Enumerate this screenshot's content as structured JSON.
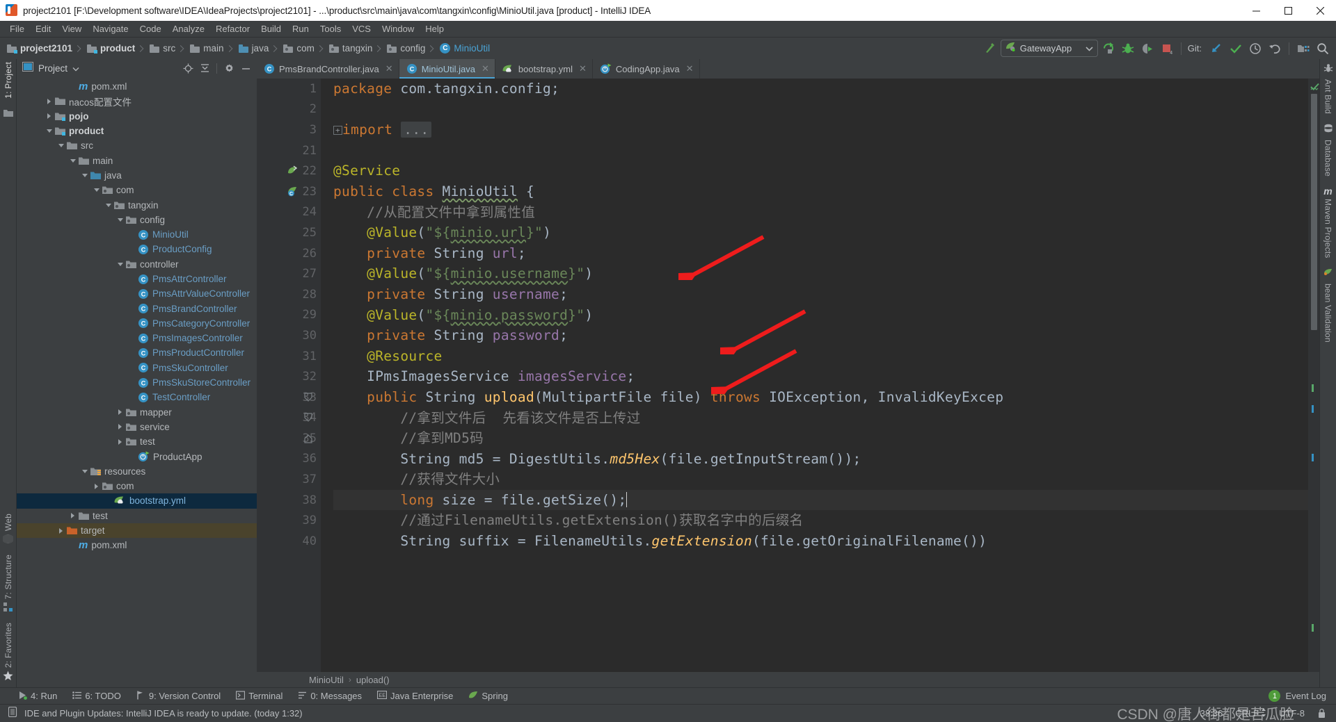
{
  "window": {
    "title": "project2101 [F:\\Development software\\IDEA\\IdeaProjects\\project2101] - ...\\product\\src\\main\\java\\com\\tangxin\\config\\MinioUtil.java [product] - IntelliJ IDEA",
    "minimize_label": "Minimize",
    "maximize_label": "Maximize",
    "close_label": "Close"
  },
  "menubar": {
    "items": [
      "File",
      "Edit",
      "View",
      "Navigate",
      "Code",
      "Analyze",
      "Refactor",
      "Build",
      "Run",
      "Tools",
      "VCS",
      "Window",
      "Help"
    ]
  },
  "navbar": {
    "crumbs": [
      {
        "label": "project2101",
        "icon": "folder-module-icon",
        "bold": true
      },
      {
        "label": "product",
        "icon": "folder-module-icon",
        "bold": true
      },
      {
        "label": "src",
        "icon": "folder-icon",
        "bold": false
      },
      {
        "label": "main",
        "icon": "folder-icon",
        "bold": false
      },
      {
        "label": "java",
        "icon": "folder-source-icon",
        "bold": false
      },
      {
        "label": "com",
        "icon": "folder-package-icon",
        "bold": false
      },
      {
        "label": "tangxin",
        "icon": "folder-package-icon",
        "bold": false
      },
      {
        "label": "config",
        "icon": "folder-package-icon",
        "bold": false
      },
      {
        "label": "MinioUtil",
        "icon": "class-icon",
        "bold": false
      }
    ],
    "run_config": "GatewayApp",
    "git_label": "Git:",
    "icons": [
      "build-icon",
      "run-icon",
      "debug-icon",
      "run-with-coverage-icon",
      "stop-icon",
      "git-update-icon",
      "git-commit-icon",
      "git-history-icon",
      "git-rollback-icon",
      "project-structure-icon",
      "search-everywhere-icon"
    ]
  },
  "left_strip": {
    "top": [
      "1: Project"
    ],
    "bottom": [
      "2: Favorites",
      "7: Structure",
      "Web"
    ]
  },
  "right_strip": {
    "items": [
      "Ant Build",
      "Database",
      "Maven Projects",
      "bean Validation"
    ]
  },
  "project_panel": {
    "title": "Project",
    "actions": [
      "locate-icon",
      "collapse-all-icon",
      "settings-gear-icon",
      "hide-icon"
    ],
    "tree": [
      {
        "label": "pom.xml",
        "indent": 4,
        "arrow": "none",
        "icon": "maven-icon",
        "bold": false
      },
      {
        "label": "nacos配置文件",
        "indent": 2,
        "arrow": "right",
        "icon": "folder-icon",
        "bold": false
      },
      {
        "label": "pojo",
        "indent": 2,
        "arrow": "right",
        "icon": "folder-module-icon",
        "bold": true
      },
      {
        "label": "product",
        "indent": 2,
        "arrow": "down",
        "icon": "folder-module-icon",
        "bold": true
      },
      {
        "label": "src",
        "indent": 3,
        "arrow": "down",
        "icon": "folder-icon",
        "bold": false
      },
      {
        "label": "main",
        "indent": 4,
        "arrow": "down",
        "icon": "folder-icon",
        "bold": false
      },
      {
        "label": "java",
        "indent": 5,
        "arrow": "down",
        "icon": "folder-source-icon",
        "bold": false
      },
      {
        "label": "com",
        "indent": 6,
        "arrow": "down",
        "icon": "folder-package-icon",
        "bold": false
      },
      {
        "label": "tangxin",
        "indent": 7,
        "arrow": "down",
        "icon": "folder-package-icon",
        "bold": false
      },
      {
        "label": "config",
        "indent": 8,
        "arrow": "down",
        "icon": "folder-package-icon",
        "bold": false
      },
      {
        "label": "MinioUtil",
        "indent": 9,
        "arrow": "none",
        "icon": "class-icon",
        "bold": false
      },
      {
        "label": "ProductConfig",
        "indent": 9,
        "arrow": "none",
        "icon": "class-icon",
        "bold": false
      },
      {
        "label": "controller",
        "indent": 8,
        "arrow": "down",
        "icon": "folder-package-icon",
        "bold": false
      },
      {
        "label": "PmsAttrController",
        "indent": 9,
        "arrow": "none",
        "icon": "class-icon",
        "bold": false
      },
      {
        "label": "PmsAttrValueController",
        "indent": 9,
        "arrow": "none",
        "icon": "class-icon",
        "bold": false
      },
      {
        "label": "PmsBrandController",
        "indent": 9,
        "arrow": "none",
        "icon": "class-icon",
        "bold": false
      },
      {
        "label": "PmsCategoryController",
        "indent": 9,
        "arrow": "none",
        "icon": "class-icon",
        "bold": false
      },
      {
        "label": "PmsImagesController",
        "indent": 9,
        "arrow": "none",
        "icon": "class-icon",
        "bold": false
      },
      {
        "label": "PmsProductController",
        "indent": 9,
        "arrow": "none",
        "icon": "class-icon",
        "bold": false
      },
      {
        "label": "PmsSkuController",
        "indent": 9,
        "arrow": "none",
        "icon": "class-icon",
        "bold": false
      },
      {
        "label": "PmsSkuStoreController",
        "indent": 9,
        "arrow": "none",
        "icon": "class-icon",
        "bold": false
      },
      {
        "label": "TestController",
        "indent": 9,
        "arrow": "none",
        "icon": "class-icon",
        "bold": false
      },
      {
        "label": "mapper",
        "indent": 8,
        "arrow": "right",
        "icon": "folder-package-icon",
        "bold": false
      },
      {
        "label": "service",
        "indent": 8,
        "arrow": "right",
        "icon": "folder-package-icon",
        "bold": false
      },
      {
        "label": "test",
        "indent": 8,
        "arrow": "right",
        "icon": "folder-package-icon",
        "bold": false
      },
      {
        "label": "ProductApp",
        "indent": 9,
        "arrow": "none",
        "icon": "spring-app-icon",
        "bold": false
      },
      {
        "label": "resources",
        "indent": 5,
        "arrow": "down",
        "icon": "folder-resources-icon",
        "bold": false
      },
      {
        "label": "com",
        "indent": 6,
        "arrow": "right",
        "icon": "folder-package-icon",
        "bold": false
      },
      {
        "label": "bootstrap.yml",
        "indent": 7,
        "arrow": "none",
        "icon": "spring-yaml-icon",
        "bold": false,
        "selected": true
      },
      {
        "label": "test",
        "indent": 4,
        "arrow": "right",
        "icon": "folder-icon",
        "bold": false
      },
      {
        "label": "target",
        "indent": 3,
        "arrow": "right",
        "icon": "folder-excluded-icon",
        "bold": false,
        "excluded": true
      },
      {
        "label": "pom.xml",
        "indent": 4,
        "arrow": "none",
        "icon": "maven-icon",
        "bold": false
      }
    ]
  },
  "editor": {
    "tabs": [
      {
        "label": "PmsBrandController.java",
        "icon": "class-icon",
        "active": false
      },
      {
        "label": "MinioUtil.java",
        "icon": "class-icon",
        "active": true
      },
      {
        "label": "bootstrap.yml",
        "icon": "spring-yaml-icon",
        "active": false
      },
      {
        "label": "CodingApp.java",
        "icon": "spring-app-icon",
        "active": false
      }
    ],
    "line_numbers": [
      "1",
      "2",
      "3",
      "21",
      "22",
      "23",
      "24",
      "25",
      "26",
      "27",
      "28",
      "29",
      "30",
      "31",
      "32",
      "33",
      "34",
      "35",
      "36",
      "37",
      "38",
      "39",
      "40"
    ],
    "breadcrumb": [
      "MinioUtil",
      "upload()"
    ],
    "code_lines": [
      "package com.tangxin.config;",
      "",
      "import ...",
      "",
      "@Service",
      "public class MinioUtil {",
      "    //从配置文件中拿到属性值",
      "    @Value(\"${minio.url}\")",
      "    private String url;",
      "    @Value(\"${minio.username}\")",
      "    private String username;",
      "    @Value(\"${minio.password}\")",
      "    private String password;",
      "    @Resource",
      "    IPmsImagesService imagesService;",
      "    public String upload(MultipartFile file) throws IOException, InvalidKeyExcep",
      "        //拿到文件后  先看该文件是否上传过",
      "        //拿到MD5码",
      "        String md5 = DigestUtils.md5Hex(file.getInputStream());",
      "        //获得文件大小",
      "        long size = file.getSize();",
      "        //通过FilenameUtils.getExtension()获取名字中的后缀名",
      "        String suffix = FilenameUtils.getExtension(file.getOriginalFilename());"
    ]
  },
  "tool_windows": {
    "items": [
      {
        "label": "4: Run",
        "icon": "run-icon"
      },
      {
        "label": "6: TODO",
        "icon": "todo-icon"
      },
      {
        "label": "9: Version Control",
        "icon": "vcs-icon"
      },
      {
        "label": "Terminal",
        "icon": "terminal-icon"
      },
      {
        "label": "0: Messages",
        "icon": "messages-icon"
      },
      {
        "label": "Java Enterprise",
        "icon": "java-enterprise-icon"
      },
      {
        "label": "Spring",
        "icon": "spring-icon"
      }
    ],
    "event_log": "Event Log",
    "event_log_count": "1"
  },
  "statusbar": {
    "message": "IDE and Plugin Updates: IntelliJ IDEA is ready to update. (today 1:32)",
    "caret": "38:36",
    "line_separator": "CRLF",
    "encoding": "UTF-8",
    "watermark": "CSDN @唐人街都是苦瓜脸"
  },
  "colors": {
    "accent": "#4aa3d5",
    "panel": "#3c3f41",
    "editor_bg": "#2b2b2b",
    "gutter": "#313335",
    "keyword": "#cc7832",
    "string": "#6a8759",
    "annotation": "#bbb529",
    "field": "#9876aa",
    "comment": "#808080",
    "method": "#ffc66d",
    "selection": "#0d293e",
    "excluded": "#4a432c",
    "arrow_annotation": "#ee1c1c"
  }
}
